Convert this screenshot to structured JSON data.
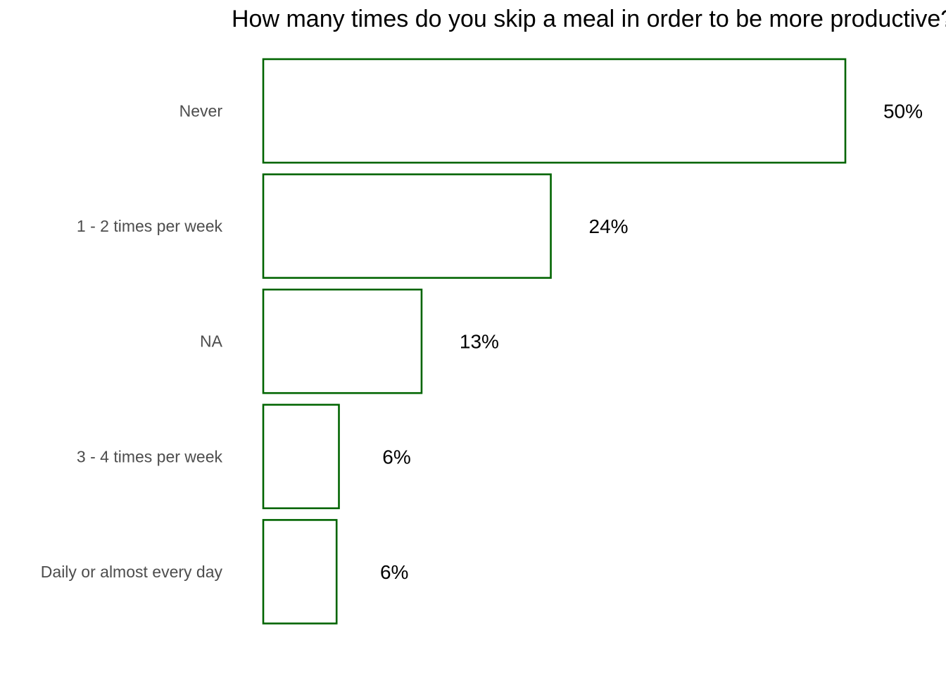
{
  "chart_data": {
    "type": "bar",
    "orientation": "horizontal",
    "title": "How many times do you skip a meal in order to be more productive?",
    "categories": [
      "Never",
      "1 - 2 times per week",
      "NA",
      "3 - 4 times per week",
      "Daily or almost every day"
    ],
    "values": [
      50,
      24.7,
      13.6,
      6.5,
      6.3
    ],
    "value_labels": [
      "50%",
      "24%",
      "13%",
      "6%",
      "6%"
    ],
    "xlabel": "",
    "ylabel": "",
    "grid": false,
    "legend": "none",
    "bar_fill": "#ffffff",
    "bar_stroke": "#006400"
  }
}
